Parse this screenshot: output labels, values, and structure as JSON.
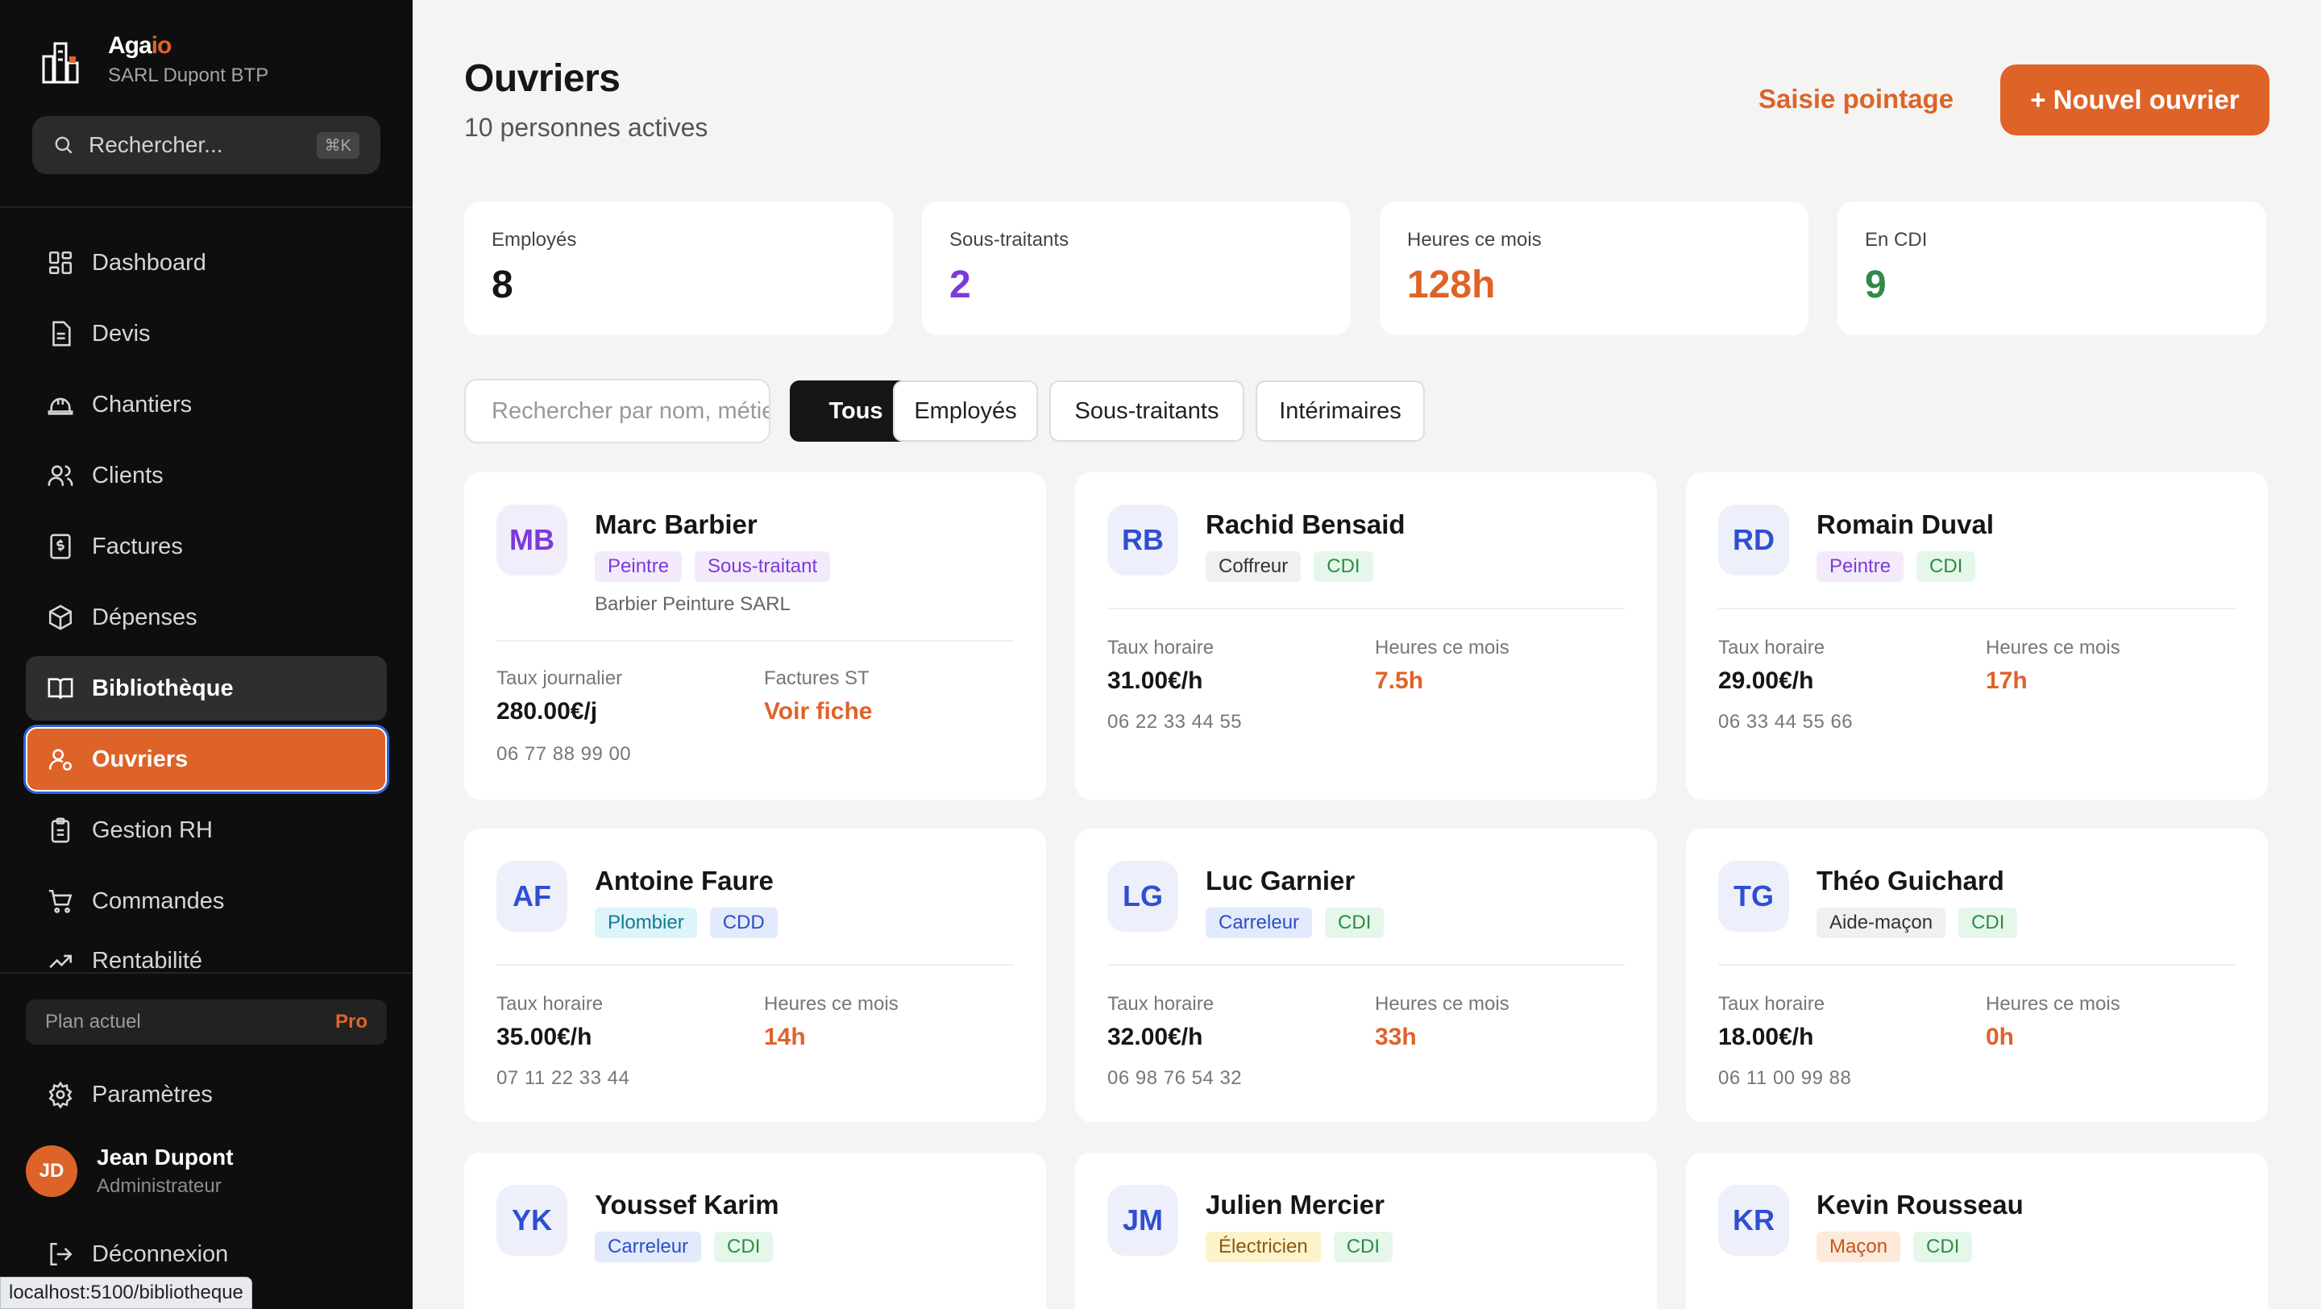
{
  "brand": {
    "name_main": "Aga",
    "name_accent": "io",
    "company": "SARL Dupont BTP"
  },
  "sidebar": {
    "search_placeholder": "Rechercher...",
    "search_shortcut": "⌘K",
    "nav": [
      {
        "label": "Dashboard",
        "icon": "dashboard-icon"
      },
      {
        "label": "Devis",
        "icon": "document-icon"
      },
      {
        "label": "Chantiers",
        "icon": "hard-hat-icon"
      },
      {
        "label": "Clients",
        "icon": "users-icon"
      },
      {
        "label": "Factures",
        "icon": "invoice-icon"
      },
      {
        "label": "Dépenses",
        "icon": "box-icon"
      },
      {
        "label": "Bibliothèque",
        "icon": "book-icon"
      },
      {
        "label": "Ouvriers",
        "icon": "worker-icon"
      },
      {
        "label": "Gestion RH",
        "icon": "clipboard-icon"
      },
      {
        "label": "Commandes",
        "icon": "cart-icon"
      },
      {
        "label": "Rentabilité",
        "icon": "chart-icon"
      }
    ],
    "plan_label": "Plan actuel",
    "plan_value": "Pro",
    "settings_label": "Paramètres",
    "user": {
      "initials": "JD",
      "name": "Jean Dupont",
      "role": "Administrateur"
    },
    "logout_label": "Déconnexion"
  },
  "status_url": "localhost:5100/bibliotheque",
  "header": {
    "title": "Ouvriers",
    "subtitle": "10 personnes actives",
    "secondary_action": "Saisie pointage",
    "primary_action": "+ Nouvel ouvrier"
  },
  "stats": [
    {
      "label": "Employés",
      "value": "8",
      "color": "#161616"
    },
    {
      "label": "Sous-traitants",
      "value": "2",
      "color": "#7c3ad8"
    },
    {
      "label": "Heures ce mois",
      "value": "128h",
      "color": "#de6329"
    },
    {
      "label": "En CDI",
      "value": "9",
      "color": "#2f8a45"
    }
  ],
  "filters": {
    "search_placeholder": "Rechercher par nom, métier...",
    "tabs": [
      "Tous",
      "Employés",
      "Sous-traitants",
      "Intérimaires"
    ],
    "active": 0
  },
  "workers": [
    {
      "initials": "MB",
      "name": "Marc Barbier",
      "tags": [
        {
          "label": "Peintre",
          "style": "violet"
        },
        {
          "label": "Sous-traitant",
          "style": "violet"
        }
      ],
      "company": "Barbier Peinture SARL",
      "m1_label": "Taux journalier",
      "m1_value": "280.00€/j",
      "m2_label": "Factures ST",
      "m2_value": "Voir fiche",
      "phone": "06 77 88 99 00"
    },
    {
      "initials": "RB",
      "name": "Rachid Bensaid",
      "tags": [
        {
          "label": "Coffreur",
          "style": "gray"
        },
        {
          "label": "CDI",
          "style": "green"
        }
      ],
      "m1_label": "Taux horaire",
      "m1_value": "31.00€/h",
      "m2_label": "Heures ce mois",
      "m2_value": "7.5h",
      "phone": "06 22 33 44 55"
    },
    {
      "initials": "RD",
      "name": "Romain Duval",
      "tags": [
        {
          "label": "Peintre",
          "style": "violet"
        },
        {
          "label": "CDI",
          "style": "green"
        }
      ],
      "m1_label": "Taux horaire",
      "m1_value": "29.00€/h",
      "m2_label": "Heures ce mois",
      "m2_value": "17h",
      "phone": "06 33 44 55 66"
    },
    {
      "initials": "AF",
      "name": "Antoine Faure",
      "tags": [
        {
          "label": "Plombier",
          "style": "cyan"
        },
        {
          "label": "CDD",
          "style": "blue"
        }
      ],
      "m1_label": "Taux horaire",
      "m1_value": "35.00€/h",
      "m2_label": "Heures ce mois",
      "m2_value": "14h",
      "phone": "07 11 22 33 44"
    },
    {
      "initials": "LG",
      "name": "Luc Garnier",
      "tags": [
        {
          "label": "Carreleur",
          "style": "blue"
        },
        {
          "label": "CDI",
          "style": "green"
        }
      ],
      "m1_label": "Taux horaire",
      "m1_value": "32.00€/h",
      "m2_label": "Heures ce mois",
      "m2_value": "33h",
      "phone": "06 98 76 54 32"
    },
    {
      "initials": "TG",
      "name": "Théo Guichard",
      "tags": [
        {
          "label": "Aide-maçon",
          "style": "gray"
        },
        {
          "label": "CDI",
          "style": "green"
        }
      ],
      "m1_label": "Taux horaire",
      "m1_value": "18.00€/h",
      "m2_label": "Heures ce mois",
      "m2_value": "0h",
      "phone": "06 11 00 99 88"
    },
    {
      "initials": "YK",
      "name": "Youssef Karim",
      "tags": [
        {
          "label": "Carreleur",
          "style": "blue"
        },
        {
          "label": "CDI",
          "style": "green"
        }
      ]
    },
    {
      "initials": "JM",
      "name": "Julien Mercier",
      "tags": [
        {
          "label": "Électricien",
          "style": "yellow"
        },
        {
          "label": "CDI",
          "style": "green"
        }
      ]
    },
    {
      "initials": "KR",
      "name": "Kevin Rousseau",
      "tags": [
        {
          "label": "Maçon",
          "style": "orange"
        },
        {
          "label": "CDI",
          "style": "green"
        }
      ]
    }
  ],
  "colors": {
    "accent": "#de6329",
    "sidebar_bg": "#0e0e0e",
    "page_bg": "#f4f4f2"
  }
}
